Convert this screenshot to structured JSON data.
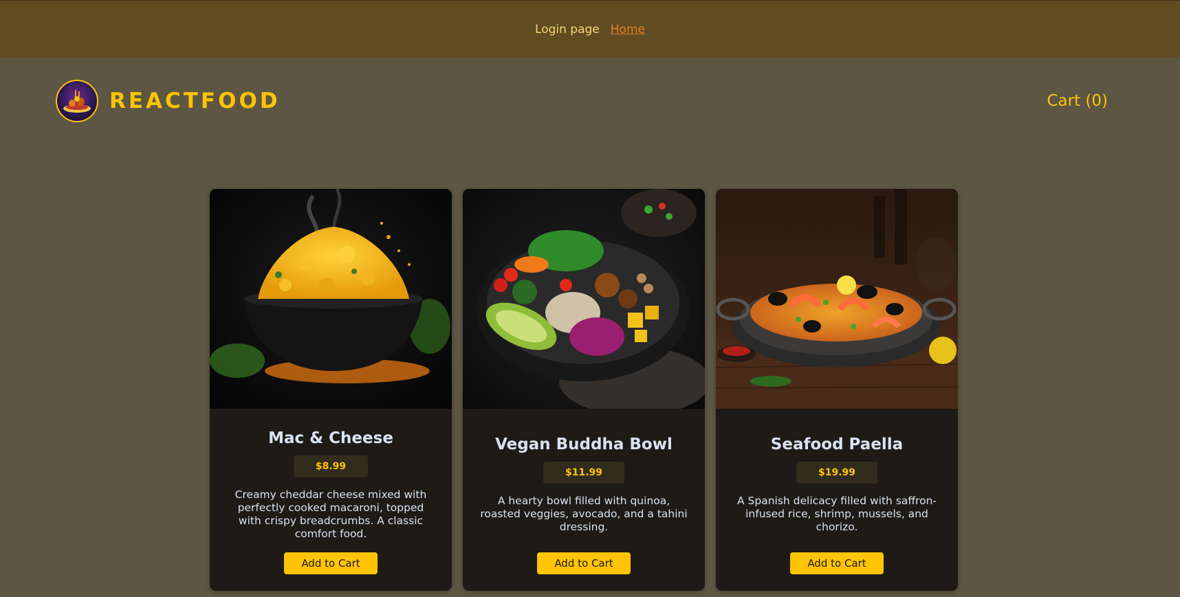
{
  "topnav": {
    "login_label": "Login page",
    "home_label": "Home"
  },
  "header": {
    "brand_title": "REACTFOOD",
    "logo_icon": "restaurant-logo-icon",
    "cart_label": "Cart (0)"
  },
  "meals": [
    {
      "name": "Mac & Cheese",
      "price": "$8.99",
      "description": "Creamy cheddar cheese mixed with perfectly cooked macaroni, topped with crispy breadcrumbs. A classic comfort food.",
      "button_label": "Add to Cart",
      "image_icon": "mac-and-cheese-image"
    },
    {
      "name": "Vegan Buddha Bowl",
      "price": "$11.99",
      "description": "A hearty bowl filled with quinoa, roasted veggies, avocado, and a tahini dressing.",
      "button_label": "Add to Cart",
      "image_icon": "buddha-bowl-image"
    },
    {
      "name": "Seafood Paella",
      "price": "$19.99",
      "description": "A Spanish delicacy filled with saffron-infused rice, shrimp, mussels, and chorizo.",
      "button_label": "Add to Cart",
      "image_icon": "seafood-paella-image"
    }
  ],
  "colors": {
    "accent": "#ffc404",
    "page_background": "#5c5643",
    "topnav_background": "#614c22",
    "card_background": "#1e1b17",
    "text_light": "#d9e2f1"
  }
}
